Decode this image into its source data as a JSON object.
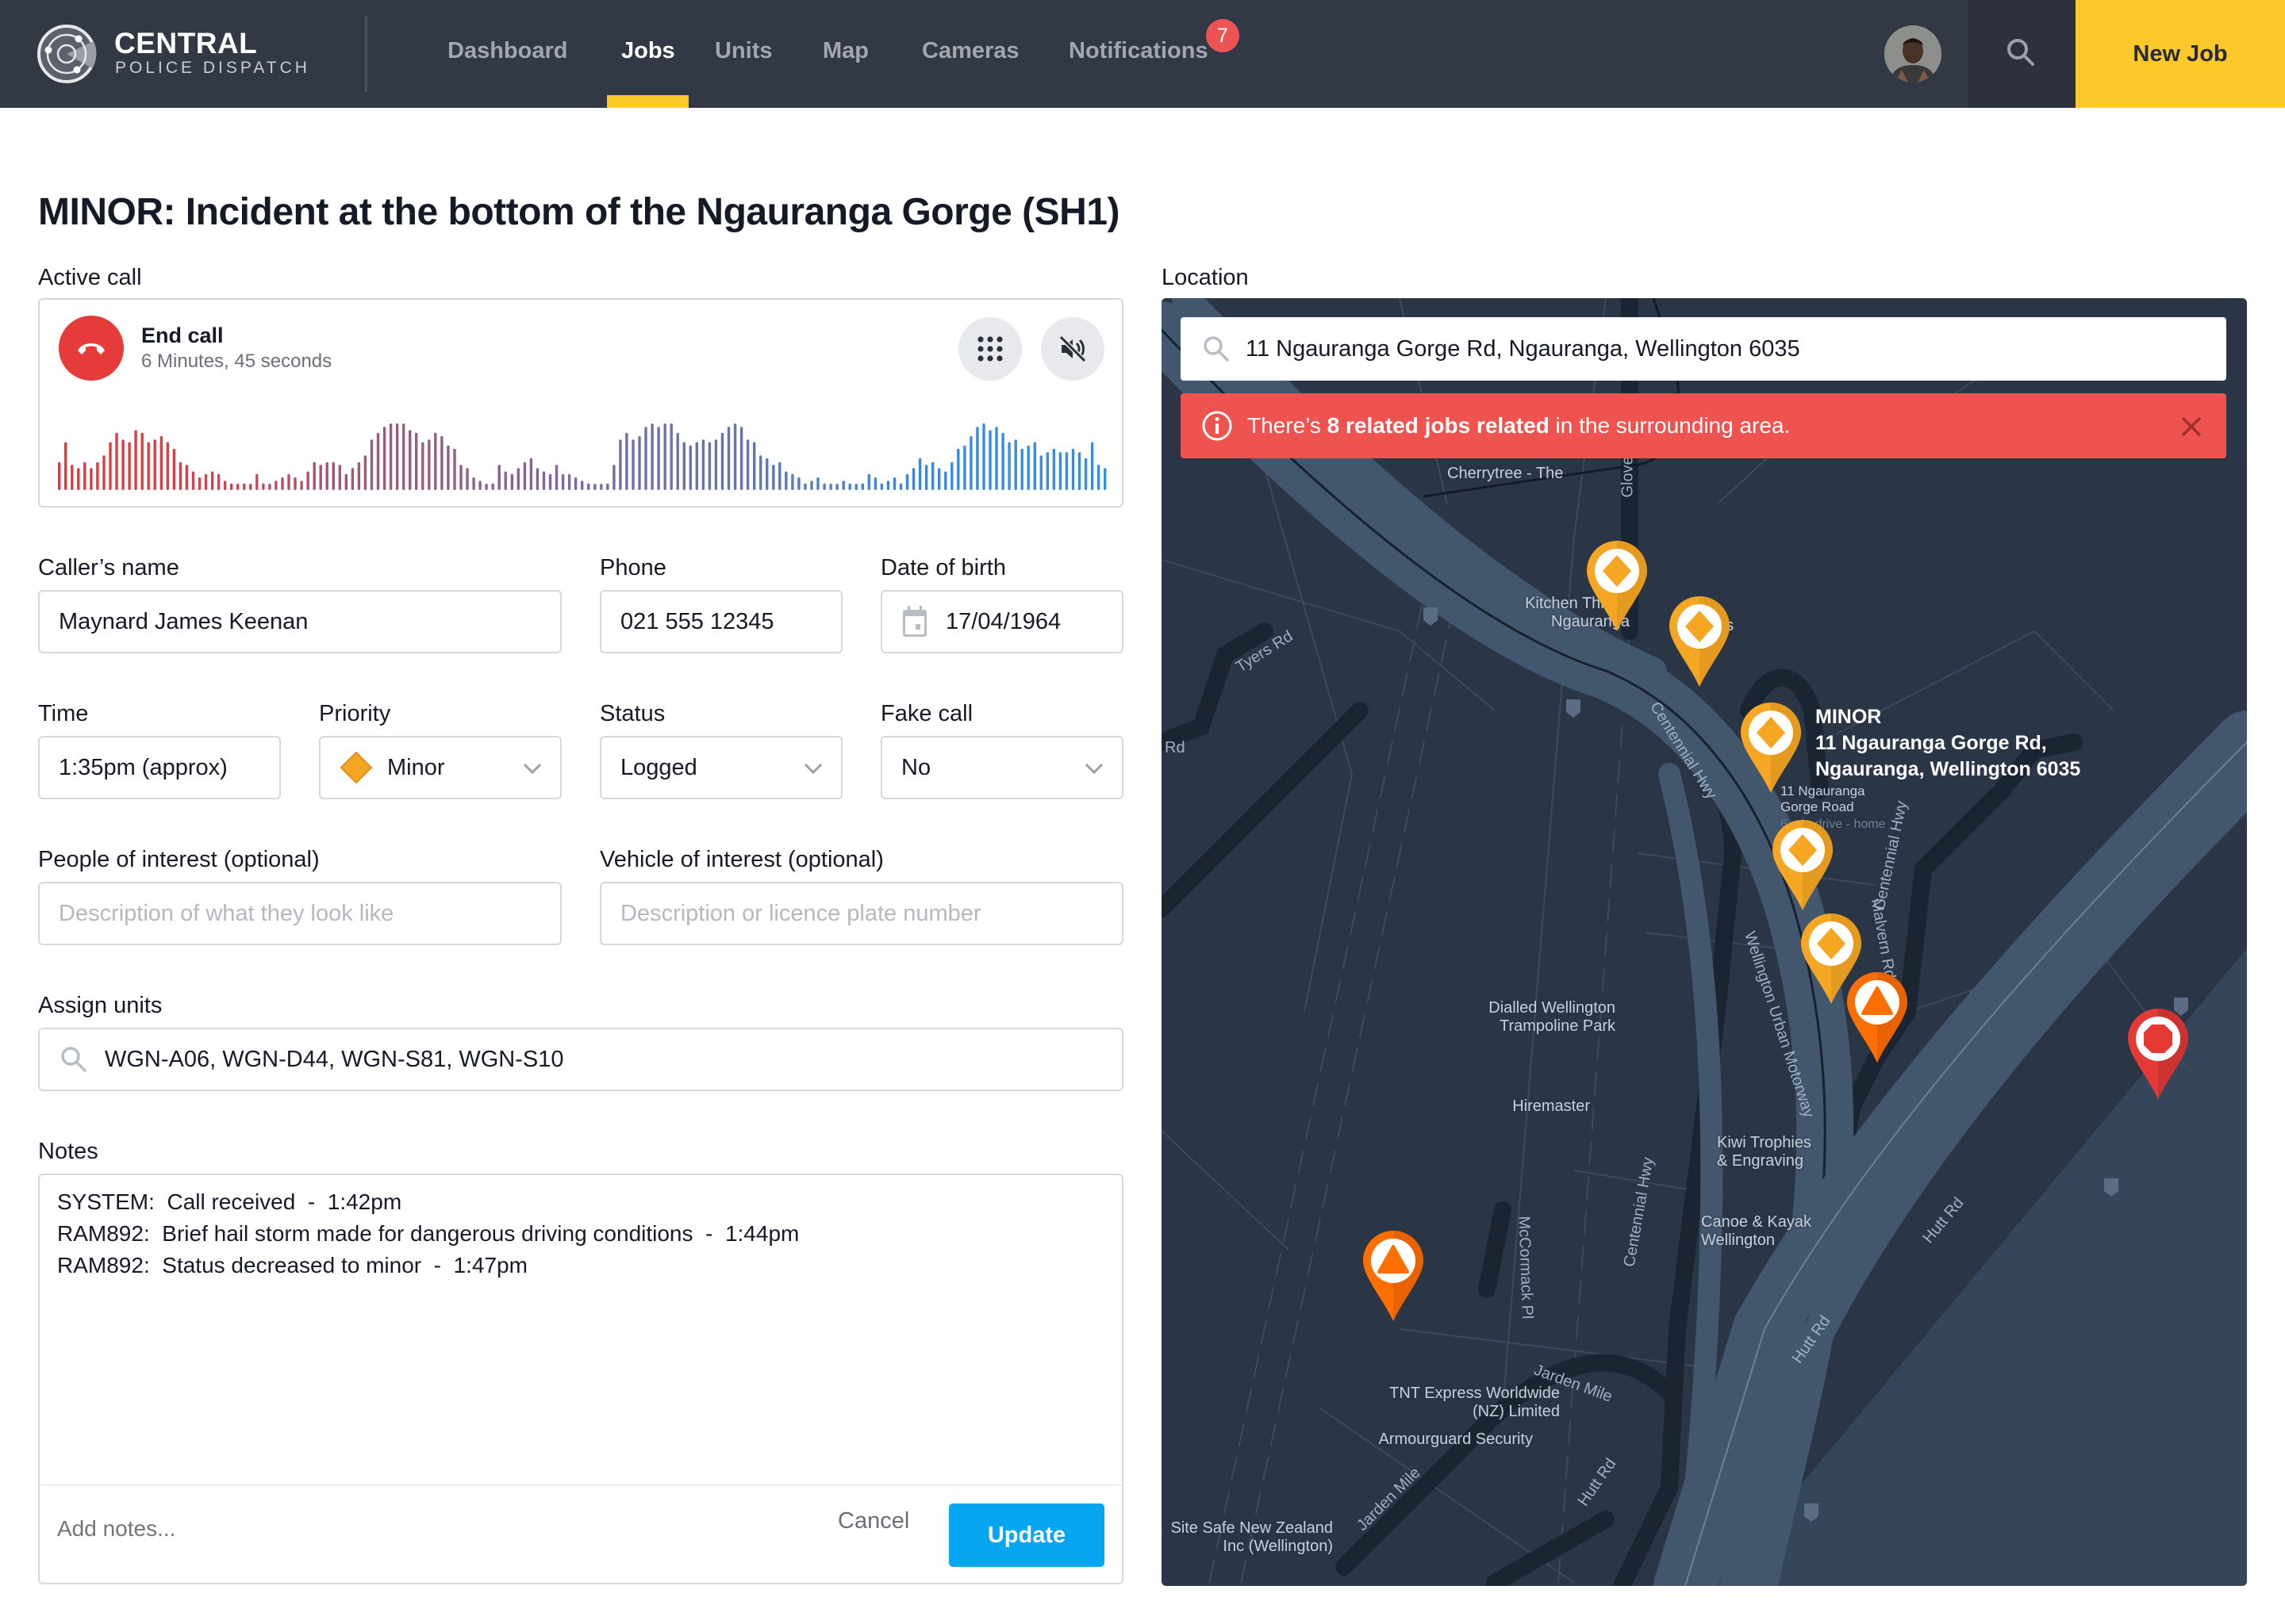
{
  "brand": {
    "title": "CENTRAL",
    "subtitle": "POLICE DISPATCH",
    "logo_icon": "radar-icon"
  },
  "nav": {
    "items": [
      {
        "label": "Dashboard",
        "active": false
      },
      {
        "label": "Jobs",
        "active": true
      },
      {
        "label": "Units",
        "active": false
      },
      {
        "label": "Map",
        "active": false
      },
      {
        "label": "Cameras",
        "active": false
      },
      {
        "label": "Notifications",
        "active": false
      }
    ],
    "notifications_count": "7",
    "search_icon": "search-icon",
    "new_job_label": "New Job",
    "accent": "#fdc829"
  },
  "page": {
    "title": "MINOR: Incident at the bottom of the Ngauranga Gorge (SH1)"
  },
  "active_call": {
    "label": "Active call",
    "end_call_label": "End call",
    "duration": "6 Minutes, 45 seconds",
    "keypad_icon": "keypad-icon",
    "mute_icon": "speaker-mute-icon",
    "waveform_levels": [
      0.42,
      0.72,
      0.38,
      0.33,
      0.42,
      0.33,
      0.42,
      0.52,
      0.72,
      0.86,
      0.76,
      0.72,
      0.9,
      0.86,
      0.72,
      0.76,
      0.81,
      0.72,
      0.62,
      0.42,
      0.38,
      0.28,
      0.19,
      0.24,
      0.28,
      0.24,
      0.14,
      0.1,
      0.05,
      0.1,
      0.05,
      0.24,
      0.1,
      0.05,
      0.14,
      0.19,
      0.24,
      0.19,
      0.14,
      0.28,
      0.42,
      0.38,
      0.42,
      0.42,
      0.38,
      0.24,
      0.33,
      0.42,
      0.52,
      0.76,
      0.86,
      0.95,
      1.0,
      1.0,
      1.0,
      0.9,
      0.86,
      0.72,
      0.76,
      0.86,
      0.81,
      0.67,
      0.62,
      0.38,
      0.33,
      0.19,
      0.14,
      0.05,
      0.1,
      0.38,
      0.28,
      0.24,
      0.33,
      0.42,
      0.48,
      0.33,
      0.28,
      0.24,
      0.38,
      0.24,
      0.24,
      0.19,
      0.14,
      0.1,
      0.05,
      0.05,
      0.1,
      0.38,
      0.76,
      0.86,
      0.76,
      0.81,
      0.95,
      1.0,
      0.95,
      1.0,
      1.0,
      0.86,
      0.72,
      0.67,
      0.72,
      0.76,
      0.72,
      0.76,
      0.86,
      0.95,
      1.0,
      0.95,
      0.76,
      0.72,
      0.52,
      0.48,
      0.38,
      0.42,
      0.28,
      0.24,
      0.19,
      0.1,
      0.14,
      0.19,
      0.1,
      0.05,
      0.05,
      0.14,
      0.1,
      0.05,
      0.1,
      0.24,
      0.19,
      0.1,
      0.14,
      0.19,
      0.1,
      0.24,
      0.33,
      0.48,
      0.38,
      0.42,
      0.33,
      0.28,
      0.42,
      0.62,
      0.67,
      0.81,
      0.95,
      1.0,
      0.9,
      0.95,
      0.86,
      0.72,
      0.76,
      0.62,
      0.67,
      0.72,
      0.52,
      0.57,
      0.62,
      0.57,
      0.57,
      0.62,
      0.57,
      0.48,
      0.72,
      0.38,
      0.33
    ],
    "waveform_colors": {
      "start": "#e53935",
      "middle": "#7a6aa0",
      "end": "#2196f3"
    }
  },
  "form": {
    "callers_name": {
      "label": "Caller’s name",
      "value": "Maynard James Keenan"
    },
    "phone": {
      "label": "Phone",
      "value": "021 555 12345"
    },
    "dob": {
      "label": "Date of birth",
      "value": "17/04/1964",
      "icon": "calendar-icon"
    },
    "time": {
      "label": "Time",
      "value": "1:35pm (approx)"
    },
    "priority": {
      "label": "Priority",
      "value": "Minor",
      "icon": "diamond-icon",
      "color": "#f5a623"
    },
    "status": {
      "label": "Status",
      "value": "Logged"
    },
    "fake_call": {
      "label": "Fake call",
      "value": "No"
    },
    "people": {
      "label": "People of interest (optional)",
      "placeholder": "Description of what they look like",
      "value": ""
    },
    "vehicle": {
      "label": "Vehicle of interest (optional)",
      "placeholder": "Description or licence plate number",
      "value": ""
    },
    "units": {
      "label": "Assign units",
      "value": "WGN-A06, WGN-D44, WGN-S81, WGN-S10"
    }
  },
  "notes": {
    "label": "Notes",
    "entries": [
      "SYSTEM:  Call received  -  1:42pm",
      "RAM892:  Brief hail storm made for dangerous driving conditions  -  1:44pm",
      "RAM892:  Status decreased to minor  -  1:47pm"
    ],
    "placeholder": "Add notes...",
    "cancel_label": "Cancel",
    "update_label": "Update"
  },
  "location": {
    "label": "Location",
    "address": "11 Ngauranga Gorge Rd, Ngauranga, Wellington 6035",
    "alert": {
      "prefix": "There’s ",
      "bold": "8 related jobs related",
      "suffix": " in the surrounding area."
    },
    "callout": {
      "title": "MINOR",
      "line1": "11 Ngauranga Gorge Rd,",
      "line2": "Ngauranga, Wellington 6035"
    },
    "places": [
      {
        "name": "Kitchen Things\nNgauranga"
      },
      {
        "name": "Elite ...s"
      },
      {
        "name": "11 Ngauranga\nGorge Road"
      },
      {
        "name": "6 min drive - home"
      },
      {
        "name": "Dialled Wellington\nTrampoline Park"
      },
      {
        "name": "Hiremaster"
      },
      {
        "name": "Kiwi Trophies\n& Engraving"
      },
      {
        "name": "Canoe & Kayak\nWellington"
      },
      {
        "name": "TNT Express Worldwide\n(NZ) Limited"
      },
      {
        "name": "Armourguard Security"
      },
      {
        "name": "Site Safe New Zealand\nInc (Wellington)"
      },
      {
        "name": "Cherrytree - The"
      }
    ],
    "roads": [
      "Tyers Rd",
      "Centennial Hwy",
      "Wellington Urban Motorway",
      "Malvern Rd",
      "Hutt Rd",
      "Jarden Mile",
      "McCormack Pl",
      "Glover",
      "Rd"
    ],
    "pins": [
      {
        "type": "minor",
        "icon": "diamond-icon",
        "color": "#f5a623"
      },
      {
        "type": "minor",
        "icon": "diamond-icon",
        "color": "#f5a623"
      },
      {
        "type": "minor",
        "icon": "diamond-icon",
        "color": "#f5a623",
        "selected": true
      },
      {
        "type": "minor",
        "icon": "diamond-icon",
        "color": "#f5a623"
      },
      {
        "type": "minor",
        "icon": "diamond-icon",
        "color": "#f5a623"
      },
      {
        "type": "moderate",
        "icon": "triangle-icon",
        "color": "#ff6f00"
      },
      {
        "type": "moderate",
        "icon": "triangle-icon",
        "color": "#ff6f00"
      },
      {
        "type": "critical",
        "icon": "octagon-icon",
        "color": "#e53935"
      }
    ]
  }
}
